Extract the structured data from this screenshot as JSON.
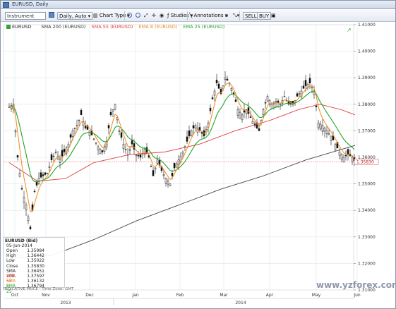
{
  "window": {
    "title": "EURUSD, Daily"
  },
  "toolbar": {
    "instrument_placeholder": "Instrument",
    "period": "Daily, Auto",
    "chart_type": "Chart Type",
    "studies": "Studies",
    "annotations": "Annotations",
    "sell": "SELL",
    "buy": "BUY"
  },
  "legend": {
    "symbol": "EURUSD",
    "sma200": "SMA 200 (EURUSD)",
    "sma55": "SMA 55 (EURUSD)",
    "ema8": "EMA 8 (EURUSD)",
    "ema25": "EMA 25 (EURUSD)"
  },
  "colors": {
    "sma200": "#444444",
    "sma55": "#e04040",
    "ema8": "#f08a1c",
    "ema25": "#22a32a",
    "candle": "#111111",
    "grid": "#e2e5ea",
    "price_line": "#e06060"
  },
  "price_label": "1.35830",
  "data_window": {
    "header": "EURUSD (Bid)",
    "date": "05-Jun-2014",
    "rows": [
      {
        "k": "Open",
        "v": "1.35984"
      },
      {
        "k": "High",
        "v": "1.36442"
      },
      {
        "k": "Low",
        "v": "1.35022"
      },
      {
        "k": "Close",
        "v": "1.35830"
      },
      {
        "k": "SMA 200",
        "v": "1.36451"
      },
      {
        "k": "SMA 55",
        "v": "1.37597"
      },
      {
        "k": "EMA 8",
        "v": "1.36132"
      },
      {
        "k": "EMA 25",
        "v": "1.36794"
      }
    ]
  },
  "indicative": "INDICATIVE PRICE - Time Zone: GMT",
  "watermark": "www.yzforex.com",
  "chart_data": {
    "type": "candlestick",
    "ylim": [
      1.31,
      1.41
    ],
    "y_ticks": [
      "1.41000",
      "1.40000",
      "1.39000",
      "1.38000",
      "1.37000",
      "1.36000",
      "1.35000",
      "1.34000",
      "1.33000",
      "1.32000",
      "1.31000"
    ],
    "x_months": [
      "Oct",
      "Nov",
      "Dec",
      "Jan",
      "Feb",
      "Mar",
      "Apr",
      "May",
      "Jun"
    ],
    "x_years": [
      "2013",
      "2014"
    ],
    "close_points": [
      [
        0,
        1.379
      ],
      [
        6,
        1.38
      ],
      [
        12,
        1.36
      ],
      [
        18,
        1.348
      ],
      [
        24,
        1.342
      ],
      [
        30,
        1.333
      ],
      [
        36,
        1.347
      ],
      [
        42,
        1.352
      ],
      [
        48,
        1.353
      ],
      [
        54,
        1.354
      ],
      [
        60,
        1.359
      ],
      [
        66,
        1.362
      ],
      [
        72,
        1.359
      ],
      [
        78,
        1.362
      ],
      [
        84,
        1.365
      ],
      [
        90,
        1.37
      ],
      [
        96,
        1.372
      ],
      [
        102,
        1.376
      ],
      [
        108,
        1.371
      ],
      [
        114,
        1.37
      ],
      [
        120,
        1.367
      ],
      [
        126,
        1.364
      ],
      [
        132,
        1.362
      ],
      [
        138,
        1.366
      ],
      [
        144,
        1.376
      ],
      [
        150,
        1.38
      ],
      [
        156,
        1.37
      ],
      [
        162,
        1.365
      ],
      [
        168,
        1.361
      ],
      [
        174,
        1.365
      ],
      [
        180,
        1.361
      ],
      [
        186,
        1.36
      ],
      [
        192,
        1.363
      ],
      [
        198,
        1.36
      ],
      [
        204,
        1.353
      ],
      [
        210,
        1.359
      ],
      [
        216,
        1.355
      ],
      [
        222,
        1.352
      ],
      [
        228,
        1.35
      ],
      [
        234,
        1.356
      ],
      [
        240,
        1.359
      ],
      [
        246,
        1.362
      ],
      [
        252,
        1.366
      ],
      [
        258,
        1.37
      ],
      [
        264,
        1.372
      ],
      [
        270,
        1.37
      ],
      [
        276,
        1.368
      ],
      [
        282,
        1.373
      ],
      [
        288,
        1.382
      ],
      [
        294,
        1.388
      ],
      [
        300,
        1.384
      ],
      [
        306,
        1.39
      ],
      [
        312,
        1.388
      ],
      [
        318,
        1.384
      ],
      [
        324,
        1.378
      ],
      [
        330,
        1.376
      ],
      [
        336,
        1.378
      ],
      [
        342,
        1.375
      ],
      [
        348,
        1.372
      ],
      [
        354,
        1.37
      ],
      [
        360,
        1.378
      ],
      [
        366,
        1.383
      ],
      [
        372,
        1.38
      ],
      [
        378,
        1.381
      ],
      [
        384,
        1.38
      ],
      [
        390,
        1.383
      ],
      [
        396,
        1.38
      ],
      [
        402,
        1.38
      ],
      [
        408,
        1.383
      ],
      [
        414,
        1.385
      ],
      [
        420,
        1.387
      ],
      [
        426,
        1.388
      ],
      [
        432,
        1.385
      ],
      [
        438,
        1.373
      ],
      [
        444,
        1.372
      ],
      [
        450,
        1.37
      ],
      [
        456,
        1.368
      ],
      [
        462,
        1.365
      ],
      [
        468,
        1.362
      ],
      [
        474,
        1.36
      ],
      [
        480,
        1.361
      ],
      [
        486,
        1.36
      ],
      [
        490,
        1.3583
      ]
    ],
    "sma200": [
      [
        0,
        1.322
      ],
      [
        60,
        1.323
      ],
      [
        120,
        1.329
      ],
      [
        180,
        1.336
      ],
      [
        240,
        1.342
      ],
      [
        300,
        1.348
      ],
      [
        360,
        1.353
      ],
      [
        420,
        1.359
      ],
      [
        490,
        1.3645
      ]
    ],
    "sma55": [
      [
        0,
        1.358
      ],
      [
        40,
        1.351
      ],
      [
        80,
        1.352
      ],
      [
        120,
        1.358
      ],
      [
        170,
        1.361
      ],
      [
        220,
        1.362
      ],
      [
        270,
        1.365
      ],
      [
        320,
        1.37
      ],
      [
        370,
        1.374
      ],
      [
        410,
        1.378
      ],
      [
        440,
        1.38
      ],
      [
        470,
        1.378
      ],
      [
        490,
        1.376
      ]
    ]
  }
}
